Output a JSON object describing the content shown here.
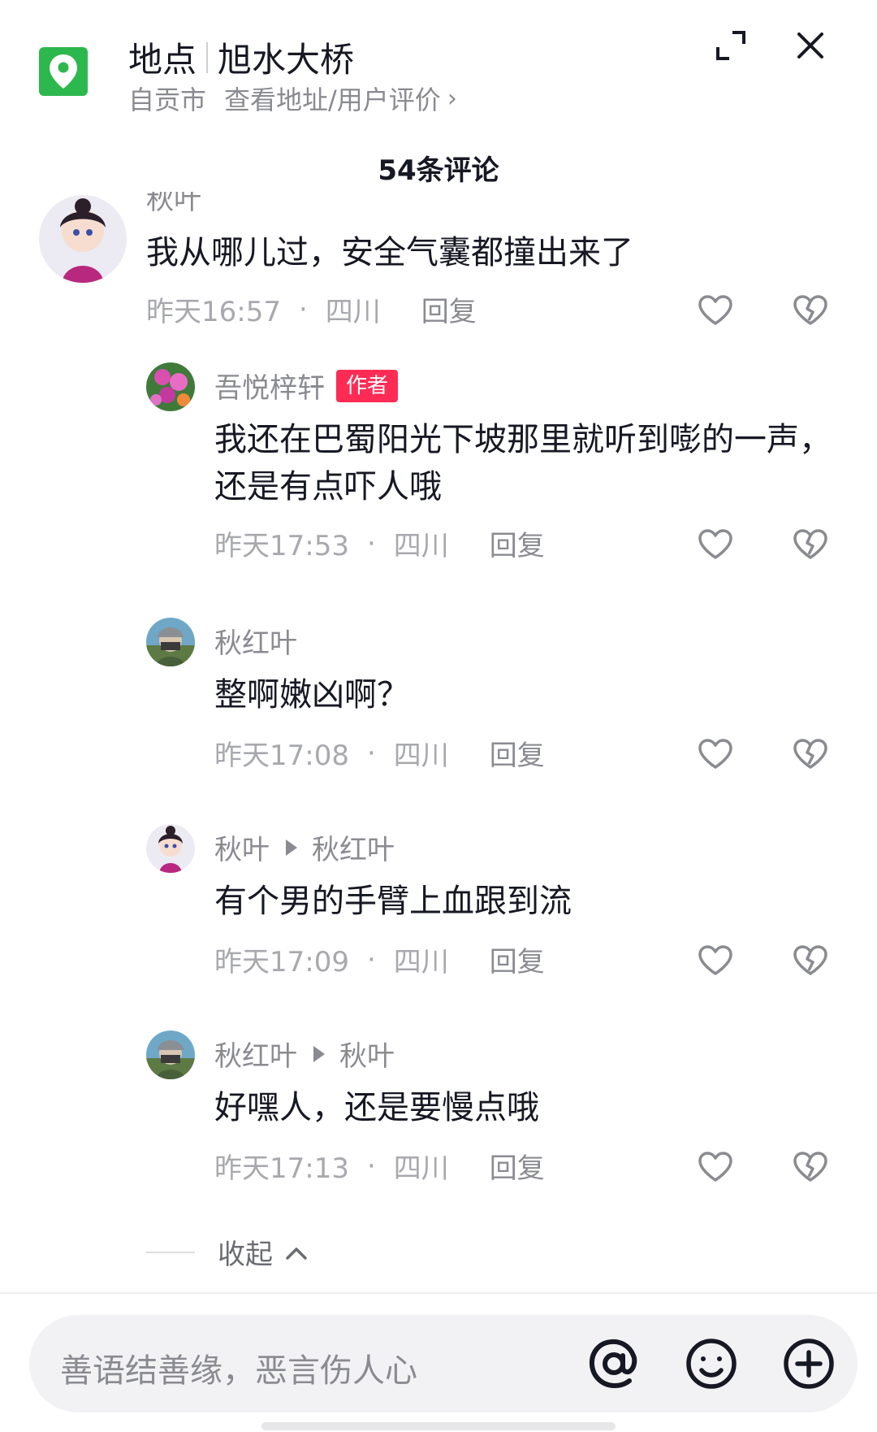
{
  "header": {
    "category": "地点",
    "place_name": "旭水大桥",
    "city": "自贡市",
    "link_text": "查看地址/用户评价",
    "chevron": "›"
  },
  "comment_count": "54条评论",
  "comments": [
    {
      "user": "秋叶",
      "text": "我从哪儿过，安全气囊都撞出来了",
      "time": "昨天16:57",
      "dot": "·",
      "region": "四川",
      "reply": "回复"
    },
    {
      "user": "吾悦梓轩",
      "badge": "作者",
      "text": "我还在巴蜀阳光下坡那里就听到嘭的一声，还是有点吓人哦",
      "time": "昨天17:53",
      "dot": "·",
      "region": "四川",
      "reply": "回复"
    },
    {
      "user": "秋红叶",
      "text": "整啊嫩凶啊？",
      "time": "昨天17:08",
      "dot": "·",
      "region": "四川",
      "reply": "回复"
    },
    {
      "user": "秋叶",
      "reply_to": "秋红叶",
      "text": "有个男的手臂上血跟到流",
      "time": "昨天17:09",
      "dot": "·",
      "region": "四川",
      "reply": "回复"
    },
    {
      "user": "秋红叶",
      "reply_to": "秋叶",
      "text": "好嘿人，还是要慢点哦",
      "time": "昨天17:13",
      "dot": "·",
      "region": "四川",
      "reply": "回复"
    }
  ],
  "collapse_label": "收起",
  "input": {
    "placeholder": "善语结善缘，恶言伤人心"
  },
  "colors": {
    "accent": "#fe2c55",
    "location_green": "#2db84d",
    "secondary_text": "#8a8b91"
  },
  "icons": [
    "location-pin-icon",
    "expand-icon",
    "close-icon",
    "like-heart-icon",
    "dislike-broken-heart-icon",
    "chevron-up-icon",
    "at-icon",
    "emoji-icon",
    "plus-icon"
  ]
}
